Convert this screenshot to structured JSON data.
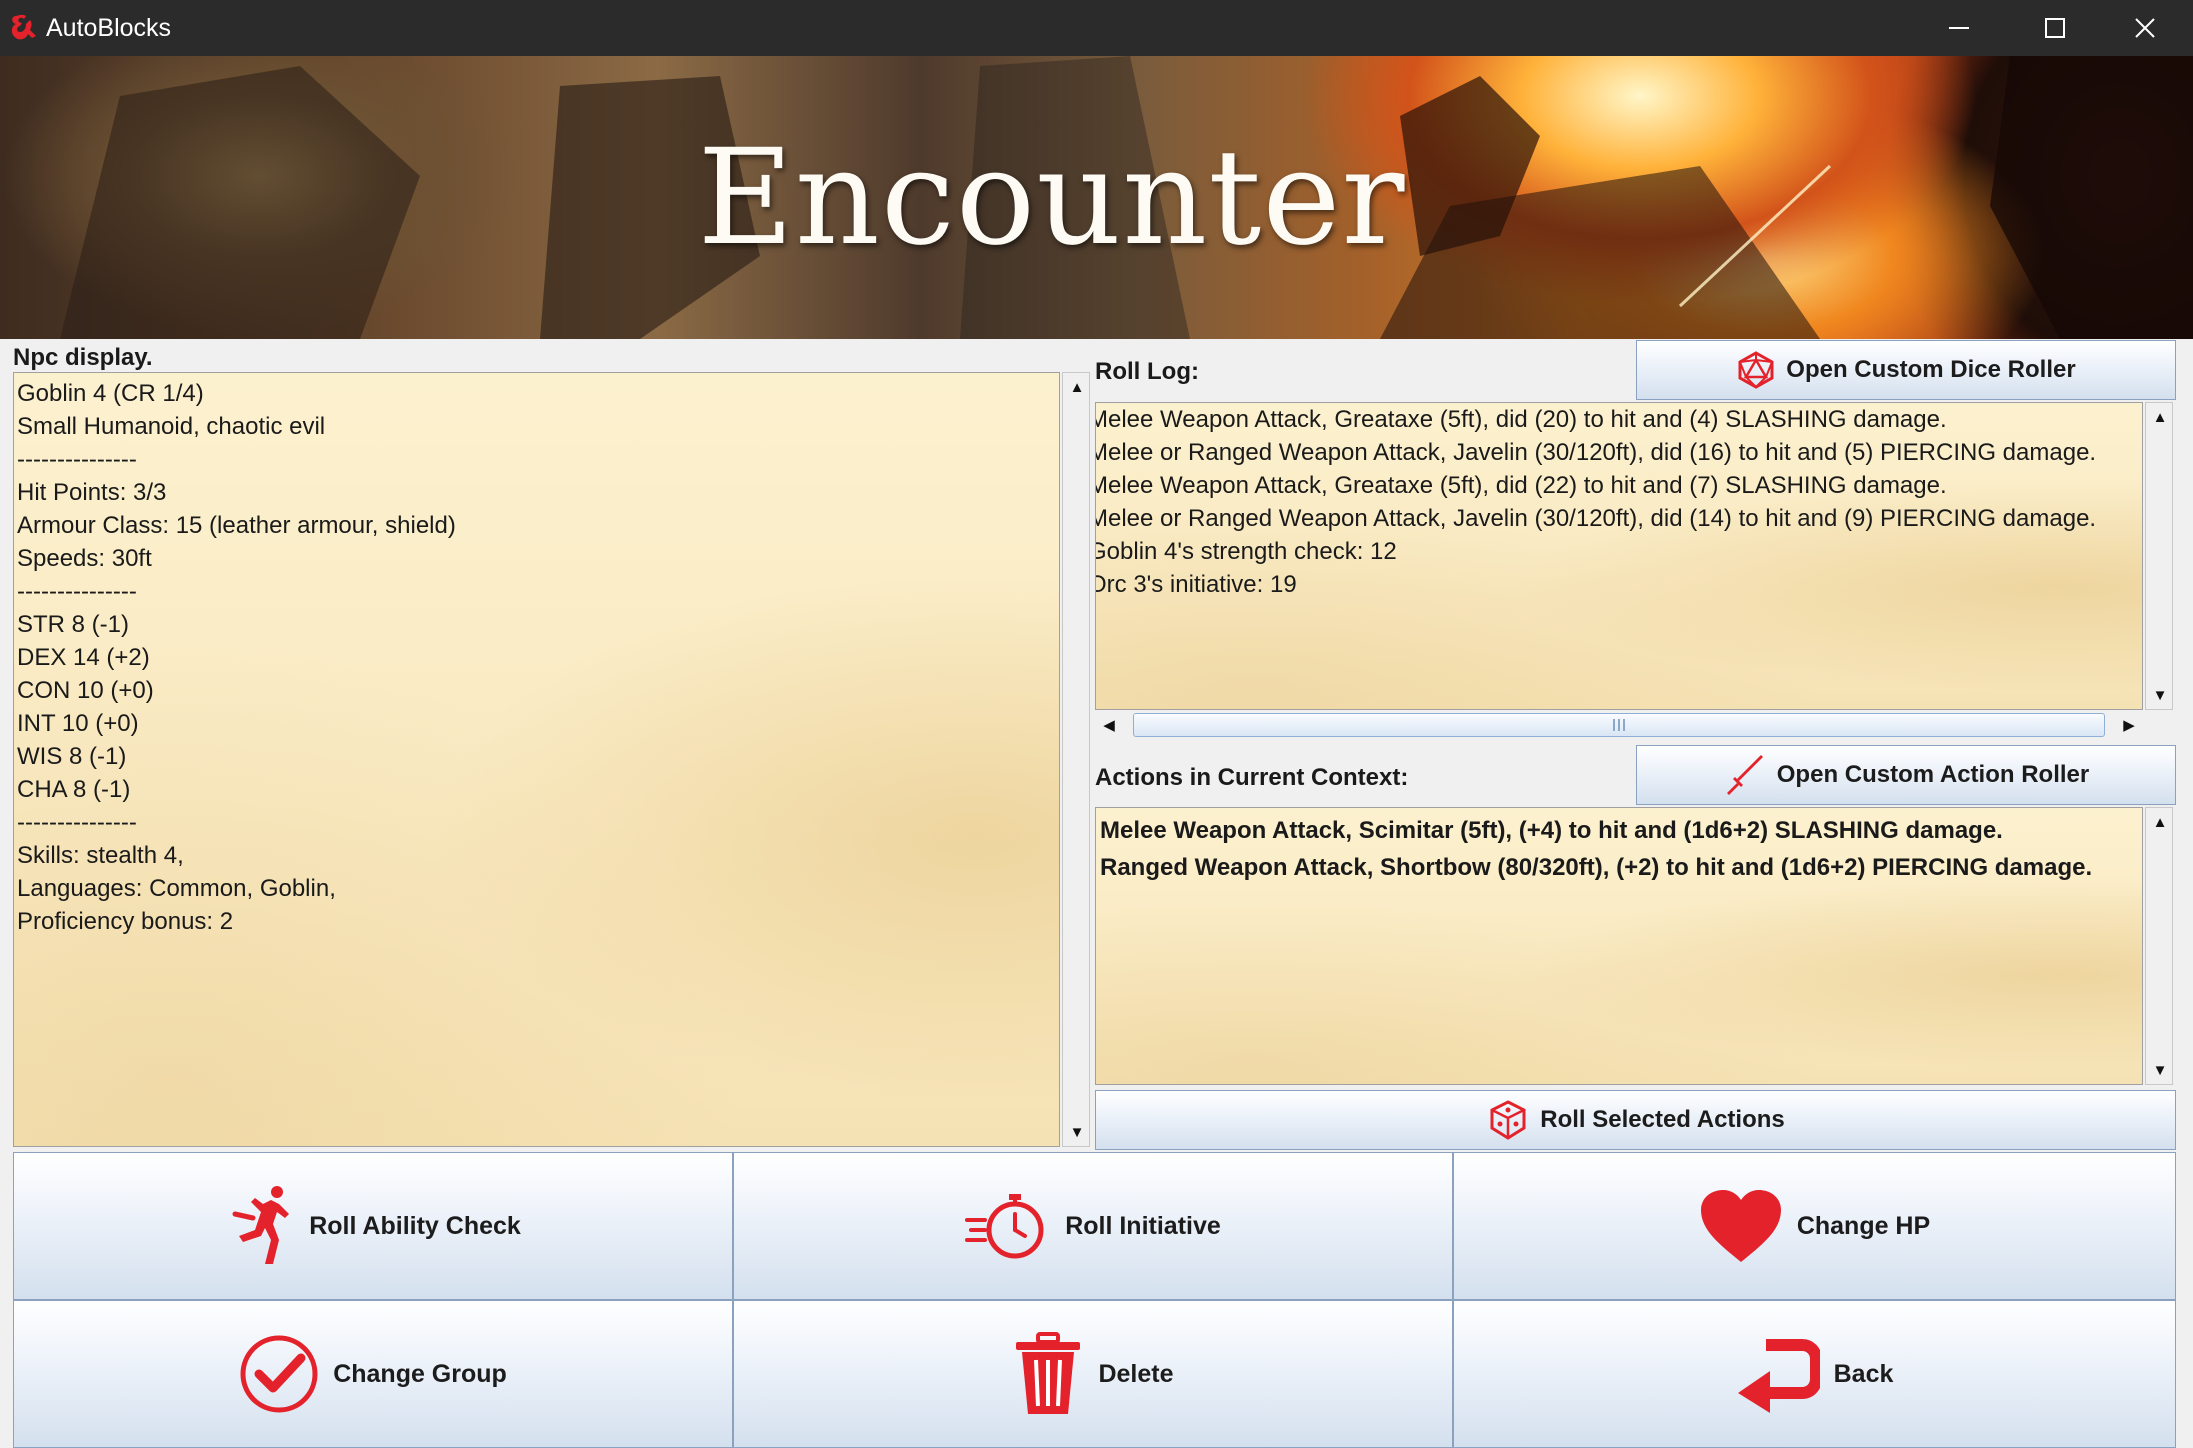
{
  "window": {
    "title": "AutoBlocks",
    "minimize_icon": "minimize-icon",
    "maximize_icon": "maximize-icon",
    "close_icon": "close-icon"
  },
  "banner": {
    "title": "Encounter"
  },
  "npc_display": {
    "label": "Npc display.",
    "lines": [
      "Goblin 4 (CR 1/4)",
      "Small Humanoid, chaotic evil",
      "---------------",
      "Hit Points: 3/3",
      "Armour Class: 15 (leather armour, shield)",
      "Speeds: 30ft",
      "---------------",
      "STR 8 (-1)",
      "DEX 14 (+2)",
      "CON 10 (+0)",
      "INT 10 (+0)",
      "WIS 8 (-1)",
      "CHA 8 (-1)",
      "---------------",
      "Skills: stealth 4,",
      "Languages: Common, Goblin,",
      "Proficiency bonus: 2"
    ]
  },
  "roll_log": {
    "label": "Roll Log:",
    "button_label": "Open Custom Dice Roller",
    "button_icon": "d20-icon",
    "lines": [
      "Melee Weapon Attack, Greataxe (5ft), did (20) to hit and (4) SLASHING damage.",
      "Melee or Ranged Weapon Attack, Javelin (30/120ft), did (16) to hit and (5) PIERCING damage.",
      "Melee Weapon Attack, Greataxe (5ft), did (22) to hit and (7) SLASHING damage.",
      "Melee or Ranged Weapon Attack, Javelin (30/120ft), did (14) to hit and (9) PIERCING damage.",
      "Goblin 4's strength check: 12",
      "Orc 3's initiative: 19"
    ]
  },
  "actions": {
    "label": "Actions in Current Context:",
    "button_label": "Open Custom Action Roller",
    "button_icon": "sword-icon",
    "lines": [
      "Melee Weapon Attack, Scimitar (5ft), (+4) to hit and (1d6+2) SLASHING damage.",
      "Ranged Weapon Attack, Shortbow (80/320ft), (+2) to hit and (1d6+2) PIERCING damage."
    ],
    "roll_selected_label": "Roll Selected Actions",
    "roll_selected_icon": "dice-icon"
  },
  "bottom_buttons": [
    {
      "label": "Roll Ability Check",
      "icon": "running-figure-icon"
    },
    {
      "label": "Roll Initiative",
      "icon": "stopwatch-icon"
    },
    {
      "label": "Change HP",
      "icon": "heart-icon"
    },
    {
      "label": "Change Group",
      "icon": "checkmark-icon"
    },
    {
      "label": "Delete",
      "icon": "trash-icon"
    },
    {
      "label": "Back",
      "icon": "back-arrow-icon"
    }
  ],
  "colors": {
    "accent_red": "#e4222b",
    "titlebar": "#2b2b2b",
    "parchment": "#f9e9c1",
    "button_border": "#8aa2c0"
  }
}
